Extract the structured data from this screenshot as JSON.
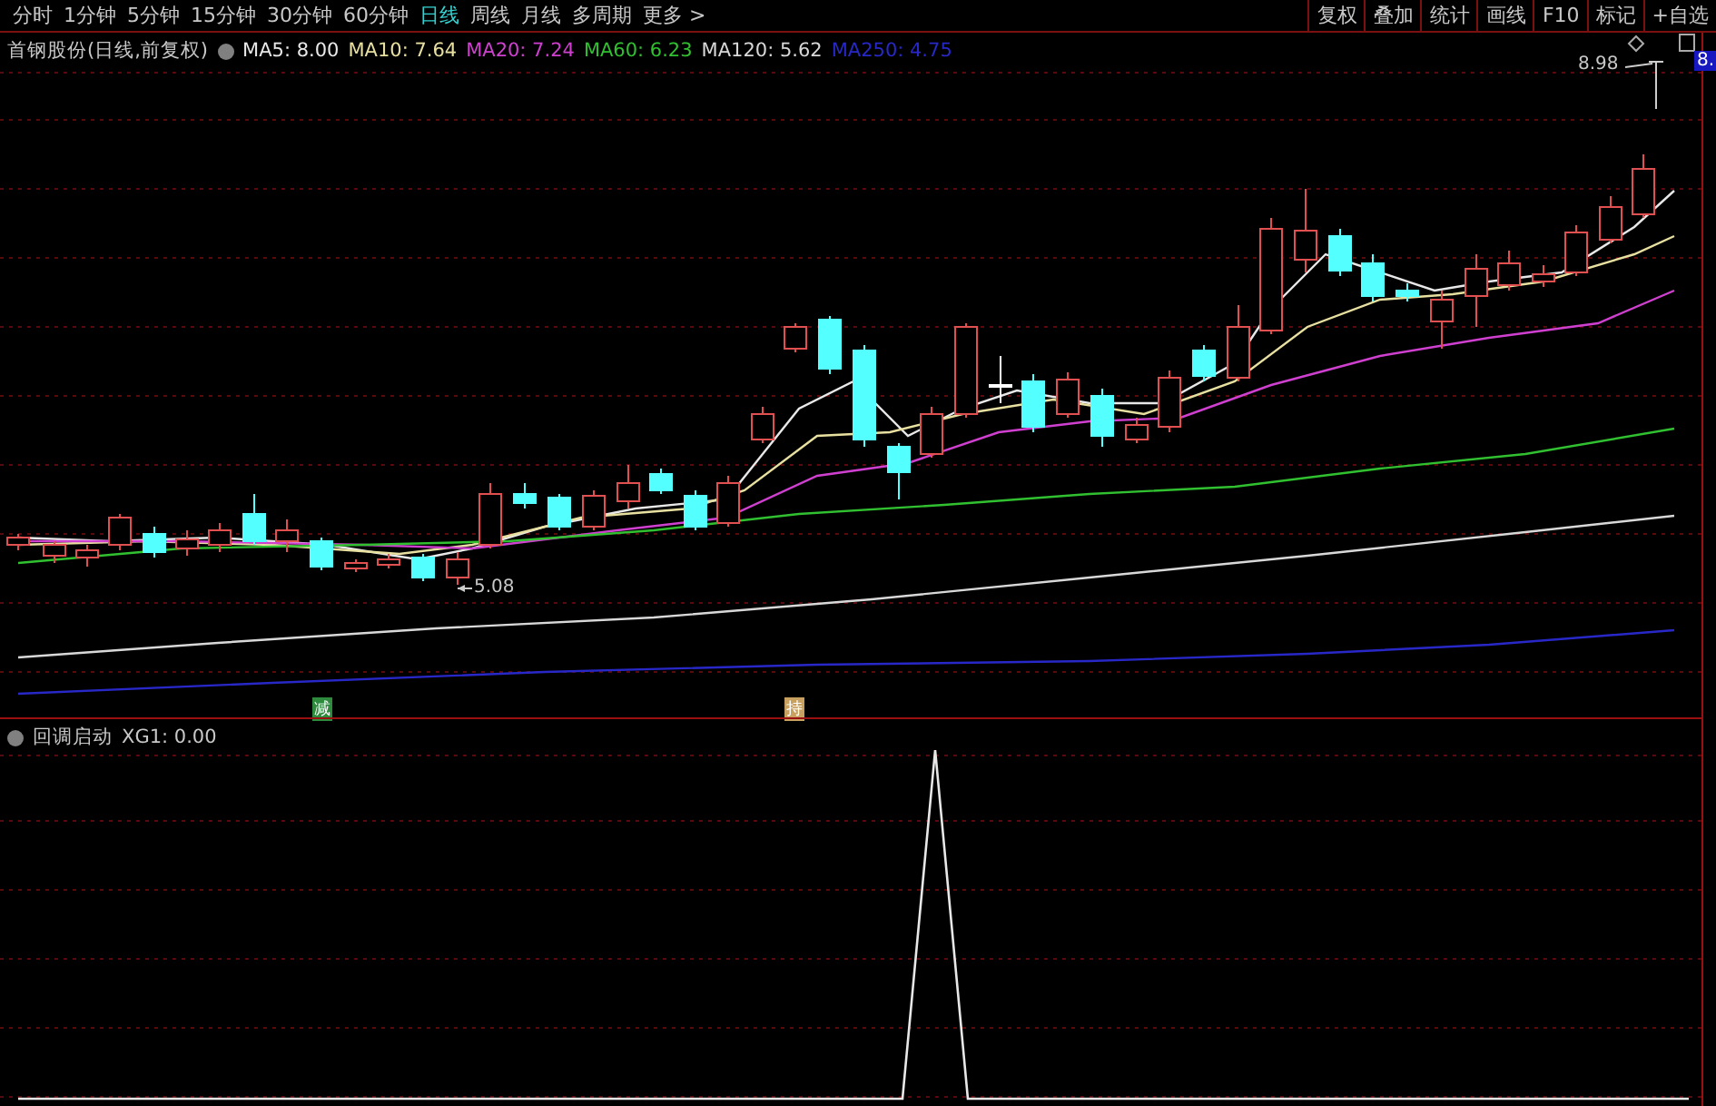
{
  "toolbar": {
    "periods": [
      {
        "label": "分时",
        "selected": false
      },
      {
        "label": "1分钟",
        "selected": false
      },
      {
        "label": "5分钟",
        "selected": false
      },
      {
        "label": "15分钟",
        "selected": false
      },
      {
        "label": "30分钟",
        "selected": false
      },
      {
        "label": "60分钟",
        "selected": false
      },
      {
        "label": "日线",
        "selected": true
      },
      {
        "label": "周线",
        "selected": false
      },
      {
        "label": "月线",
        "selected": false
      },
      {
        "label": "多周期",
        "selected": false
      },
      {
        "label": "更多 >",
        "selected": false
      }
    ],
    "buttons": [
      "复权",
      "叠加",
      "统计",
      "画线",
      "F10",
      "标记",
      "+自选"
    ]
  },
  "main_chart": {
    "title": "首钢股份(日线,前复权)",
    "indicators": [
      {
        "label": "MA5: 8.00",
        "color": "#e8e8e8"
      },
      {
        "label": "MA10: 7.64",
        "color": "#e8e0a0"
      },
      {
        "label": "MA20: 7.24",
        "color": "#d040d0"
      },
      {
        "label": "MA60: 6.23",
        "color": "#30c030"
      },
      {
        "label": "MA120: 5.62",
        "color": "#d8d8d8"
      },
      {
        "label": "MA250: 4.75",
        "color": "#2828c8"
      }
    ],
    "high_label": "8.98",
    "low_label": "5.08",
    "axis_tag": "8.",
    "signals": [
      {
        "label": "减",
        "color": "#2e8b3e"
      },
      {
        "label": "持",
        "color": "#c8a060"
      }
    ]
  },
  "indicator_pane": {
    "title": "回调启动",
    "reading": "XG1: 0.00"
  }
}
